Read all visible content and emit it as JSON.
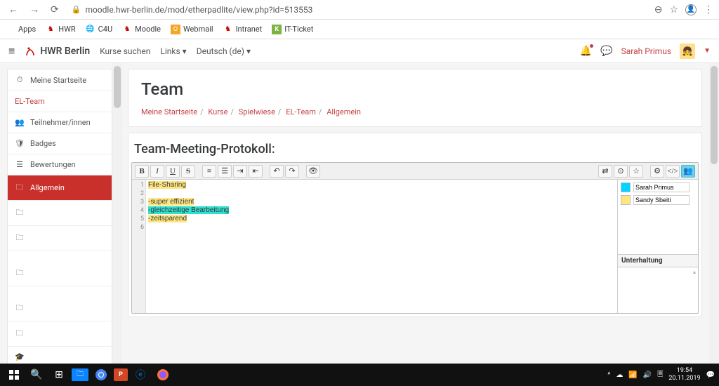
{
  "browser": {
    "url": "moodle.hwr-berlin.de/mod/etherpadlite/view.php?id=513553"
  },
  "bookmarks": {
    "apps": "Apps",
    "hwr": "HWR",
    "c4u": "C4U",
    "moodle": "Moodle",
    "webmail": "Webmail",
    "intranet": "Intranet",
    "itticket": "IT-Ticket"
  },
  "topnav": {
    "brand": "HWR Berlin",
    "links": {
      "search": "Kurse suchen",
      "links": "Links ▾",
      "lang": "Deutsch (de) ▾"
    },
    "user": "Sarah Primus"
  },
  "sidebar": {
    "home": "Meine Startseite",
    "course": "EL-Team",
    "participants": "Teilnehmer/innen",
    "badges": "Badges",
    "grades": "Bewertungen",
    "general": "Allgemein"
  },
  "page": {
    "title": "Team",
    "breadcrumb": {
      "home": "Meine Startseite",
      "courses": "Kurse",
      "spiel": "Spielwiese",
      "elteam": "EL-Team",
      "general": "Allgemein"
    },
    "activity_title": "Team-Meeting-Protokoll:"
  },
  "etherpad": {
    "lines": {
      "l1": "File-Sharing",
      "l3": "-super effizient",
      "l4": "-gleichzeitige Bearbeitung",
      "l5": "-zeitsparend"
    },
    "users": {
      "u1": "Sarah Primus",
      "u2": "Sandy Sbeiti"
    },
    "chat_title": "Unterhaltung",
    "gutter": {
      "n1": "1",
      "n2": "2",
      "n3": "3",
      "n4": "4",
      "n5": "5",
      "n6": "6"
    }
  },
  "taskbar": {
    "time": "19:54",
    "date": "20.11.2019"
  }
}
